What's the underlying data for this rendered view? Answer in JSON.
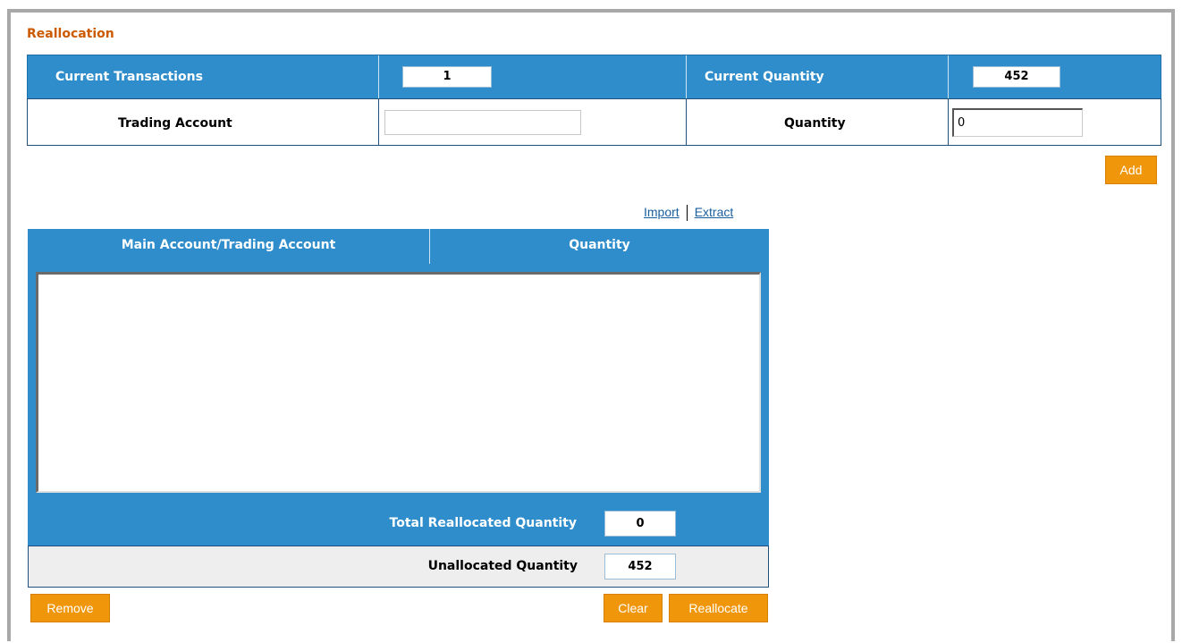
{
  "page": {
    "title": "Reallocation"
  },
  "summary": {
    "current_transactions_label": "Current Transactions",
    "current_transactions_value": "1",
    "current_quantity_label": "Current Quantity",
    "current_quantity_value": "452"
  },
  "entry": {
    "trading_account_label": "Trading Account",
    "trading_account_value": "",
    "quantity_label": "Quantity",
    "quantity_value": "0",
    "add_label": "Add"
  },
  "links": {
    "import_label": "Import",
    "extract_label": "Extract"
  },
  "grid": {
    "columns": [
      "Main Account/Trading Account",
      "Quantity"
    ],
    "rows": []
  },
  "totals": {
    "total_reallocated_label": "Total Reallocated Quantity",
    "total_reallocated_value": "0",
    "unallocated_label": "Unallocated Quantity",
    "unallocated_value": "452"
  },
  "actions": {
    "remove_label": "Remove",
    "clear_label": "Clear",
    "reallocate_label": "Reallocate"
  },
  "colors": {
    "header_blue": "#2f8dcb",
    "title_orange": "#cc5a00",
    "button_orange": "#f0960a"
  }
}
